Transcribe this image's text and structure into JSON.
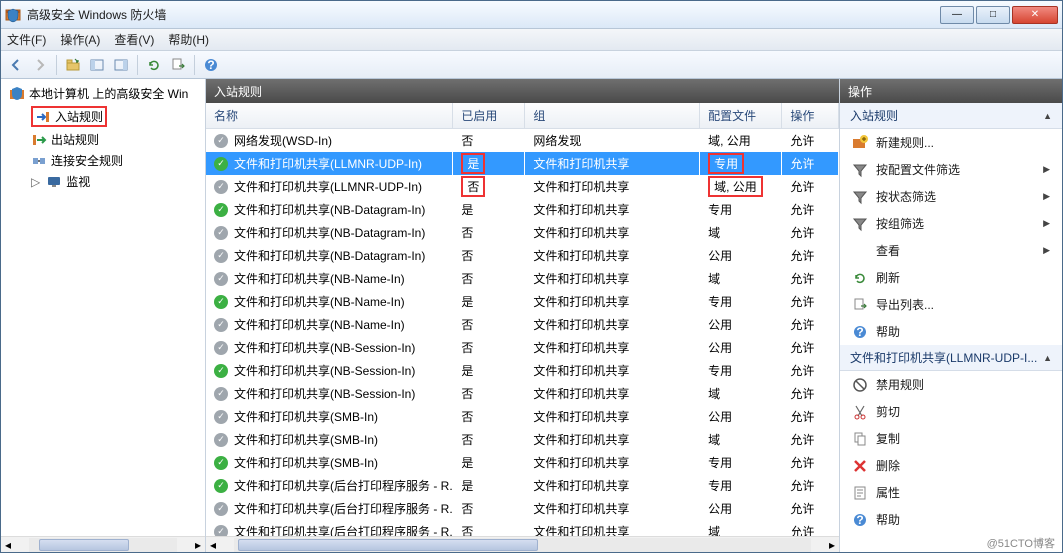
{
  "window": {
    "title": "高级安全 Windows 防火墙"
  },
  "menu": {
    "file": "文件(F)",
    "action": "操作(A)",
    "view": "查看(V)",
    "help": "帮助(H)"
  },
  "tree": {
    "root": "本地计算机 上的高级安全 Win",
    "inbound": "入站规则",
    "outbound": "出站规则",
    "connsec": "连接安全规则",
    "monitor": "监视"
  },
  "center": {
    "heading": "入站规则",
    "cols": {
      "name": "名称",
      "enabled": "已启用",
      "group": "组",
      "profile": "配置文件",
      "action": "操作"
    }
  },
  "rules": [
    {
      "on": false,
      "name": "网络发现(WSD-In)",
      "enabled": "否",
      "group": "网络发现",
      "profile": "域, 公用",
      "action": "允许",
      "sel": false,
      "rb": false
    },
    {
      "on": true,
      "name": "文件和打印机共享(LLMNR-UDP-In)",
      "enabled": "是",
      "group": "文件和打印机共享",
      "profile": "专用",
      "action": "允许",
      "sel": true,
      "rb": true
    },
    {
      "on": false,
      "name": "文件和打印机共享(LLMNR-UDP-In)",
      "enabled": "否",
      "group": "文件和打印机共享",
      "profile": "域, 公用",
      "action": "允许",
      "sel": false,
      "rb": true
    },
    {
      "on": true,
      "name": "文件和打印机共享(NB-Datagram-In)",
      "enabled": "是",
      "group": "文件和打印机共享",
      "profile": "专用",
      "action": "允许",
      "sel": false,
      "rb": false
    },
    {
      "on": false,
      "name": "文件和打印机共享(NB-Datagram-In)",
      "enabled": "否",
      "group": "文件和打印机共享",
      "profile": "域",
      "action": "允许",
      "sel": false,
      "rb": false
    },
    {
      "on": false,
      "name": "文件和打印机共享(NB-Datagram-In)",
      "enabled": "否",
      "group": "文件和打印机共享",
      "profile": "公用",
      "action": "允许",
      "sel": false,
      "rb": false
    },
    {
      "on": false,
      "name": "文件和打印机共享(NB-Name-In)",
      "enabled": "否",
      "group": "文件和打印机共享",
      "profile": "域",
      "action": "允许",
      "sel": false,
      "rb": false
    },
    {
      "on": true,
      "name": "文件和打印机共享(NB-Name-In)",
      "enabled": "是",
      "group": "文件和打印机共享",
      "profile": "专用",
      "action": "允许",
      "sel": false,
      "rb": false
    },
    {
      "on": false,
      "name": "文件和打印机共享(NB-Name-In)",
      "enabled": "否",
      "group": "文件和打印机共享",
      "profile": "公用",
      "action": "允许",
      "sel": false,
      "rb": false
    },
    {
      "on": false,
      "name": "文件和打印机共享(NB-Session-In)",
      "enabled": "否",
      "group": "文件和打印机共享",
      "profile": "公用",
      "action": "允许",
      "sel": false,
      "rb": false
    },
    {
      "on": true,
      "name": "文件和打印机共享(NB-Session-In)",
      "enabled": "是",
      "group": "文件和打印机共享",
      "profile": "专用",
      "action": "允许",
      "sel": false,
      "rb": false
    },
    {
      "on": false,
      "name": "文件和打印机共享(NB-Session-In)",
      "enabled": "否",
      "group": "文件和打印机共享",
      "profile": "域",
      "action": "允许",
      "sel": false,
      "rb": false
    },
    {
      "on": false,
      "name": "文件和打印机共享(SMB-In)",
      "enabled": "否",
      "group": "文件和打印机共享",
      "profile": "公用",
      "action": "允许",
      "sel": false,
      "rb": false
    },
    {
      "on": false,
      "name": "文件和打印机共享(SMB-In)",
      "enabled": "否",
      "group": "文件和打印机共享",
      "profile": "域",
      "action": "允许",
      "sel": false,
      "rb": false
    },
    {
      "on": true,
      "name": "文件和打印机共享(SMB-In)",
      "enabled": "是",
      "group": "文件和打印机共享",
      "profile": "专用",
      "action": "允许",
      "sel": false,
      "rb": false
    },
    {
      "on": true,
      "name": "文件和打印机共享(后台打印程序服务 - R...",
      "enabled": "是",
      "group": "文件和打印机共享",
      "profile": "专用",
      "action": "允许",
      "sel": false,
      "rb": false
    },
    {
      "on": false,
      "name": "文件和打印机共享(后台打印程序服务 - R...",
      "enabled": "否",
      "group": "文件和打印机共享",
      "profile": "公用",
      "action": "允许",
      "sel": false,
      "rb": false
    },
    {
      "on": false,
      "name": "文件和打印机共享(后台打印程序服务 - R...",
      "enabled": "否",
      "group": "文件和打印机共享",
      "profile": "域",
      "action": "允许",
      "sel": false,
      "rb": false
    }
  ],
  "actions": {
    "heading": "操作",
    "section1": "入站规则",
    "new_rule": "新建规则...",
    "filter_profile": "按配置文件筛选",
    "filter_state": "按状态筛选",
    "filter_group": "按组筛选",
    "view": "查看",
    "refresh": "刷新",
    "export": "导出列表...",
    "help": "帮助",
    "section2": "文件和打印机共享(LLMNR-UDP-I...",
    "disable": "禁用规则",
    "cut": "剪切",
    "copy": "复制",
    "delete": "删除",
    "props": "属性",
    "help2": "帮助"
  },
  "watermark": "@51CTO博客"
}
